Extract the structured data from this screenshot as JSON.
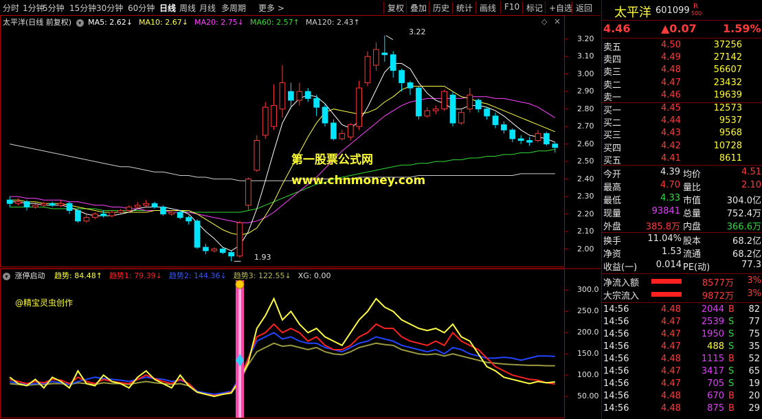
{
  "toolbar": {
    "left": [
      "分时",
      "1分钟",
      "5分钟",
      "15分钟",
      "30分钟",
      "60分钟",
      "日线",
      "周线",
      "月线",
      "多周期",
      "更多 >"
    ],
    "active_index": 6,
    "right": [
      "复权",
      "叠加",
      "历史",
      "统计",
      "画线",
      "F10",
      "标记",
      "+自选",
      "返回"
    ]
  },
  "main_legend": {
    "title": "太平洋(日线 前复权)",
    "ma": [
      {
        "label": "MA5: 2.62↓",
        "color": "#ffffff"
      },
      {
        "label": "MA10: 2.67↓",
        "color": "#ffff44"
      },
      {
        "label": "MA20: 2.75↓",
        "color": "#ff44ff"
      },
      {
        "label": "MA60: 2.57↑",
        "color": "#33dd33"
      },
      {
        "label": "MA120: 2.43↑",
        "color": "#cfcfcf"
      }
    ],
    "high_label": "3.22",
    "low_label": "1.93",
    "watermark1": "第一股票公式网",
    "watermark2": "www.chnmoney.com"
  },
  "price_axis": [
    "3.20",
    "3.10",
    "3.00",
    "2.90",
    "2.80",
    "2.70",
    "2.60",
    "2.50",
    "2.40",
    "2.30",
    "2.20",
    "2.10",
    "2.00"
  ],
  "sub_legend": {
    "title": "涨停启动",
    "items": [
      {
        "label": "趋势: 84.48↑",
        "color": "#ffff44"
      },
      {
        "label": "趋势1: 79.39↓",
        "color": "#ff2222"
      },
      {
        "label": "趋势2: 144.36↓",
        "color": "#3355ff"
      },
      {
        "label": "趋势3: 122.55↓",
        "color": "#bbbb55"
      },
      {
        "label": "XG: 0.00",
        "color": "#dddddd"
      }
    ],
    "author": "@精宝灵虫创作"
  },
  "sub_axis": [
    "300.0",
    "250.0",
    "200.0",
    "150.0",
    "100.0",
    "50.00"
  ],
  "chart_data": {
    "type": "candlestick",
    "ylim": [
      1.9,
      3.25
    ],
    "candles": [
      [
        2.28,
        2.26,
        2.3,
        2.24
      ],
      [
        2.26,
        2.27,
        2.29,
        2.25
      ],
      [
        2.27,
        2.24,
        2.28,
        2.22
      ],
      [
        2.24,
        2.25,
        2.27,
        2.23
      ],
      [
        2.25,
        2.26,
        2.27,
        2.24
      ],
      [
        2.26,
        2.25,
        2.27,
        2.24
      ],
      [
        2.25,
        2.26,
        2.28,
        2.24
      ],
      [
        2.26,
        2.22,
        2.27,
        2.2
      ],
      [
        2.22,
        2.16,
        2.23,
        2.15
      ],
      [
        2.16,
        2.18,
        2.2,
        2.15
      ],
      [
        2.18,
        2.2,
        2.21,
        2.17
      ],
      [
        2.2,
        2.19,
        2.22,
        2.18
      ],
      [
        2.19,
        2.21,
        2.22,
        2.18
      ],
      [
        2.21,
        2.22,
        2.23,
        2.2
      ],
      [
        2.22,
        2.24,
        2.25,
        2.21
      ],
      [
        2.24,
        2.25,
        2.27,
        2.23
      ],
      [
        2.25,
        2.26,
        2.28,
        2.24
      ],
      [
        2.26,
        2.24,
        2.27,
        2.23
      ],
      [
        2.24,
        2.2,
        2.25,
        2.19
      ],
      [
        2.2,
        2.21,
        2.22,
        2.19
      ],
      [
        2.21,
        2.18,
        2.22,
        2.17
      ],
      [
        2.18,
        2.16,
        2.19,
        2.14
      ],
      [
        2.16,
        2.01,
        2.17,
        2.0
      ],
      [
        2.01,
        1.99,
        2.03,
        1.97
      ],
      [
        1.99,
        2.0,
        2.01,
        1.98
      ],
      [
        2.0,
        1.98,
        2.01,
        1.97
      ],
      [
        1.98,
        1.96,
        1.99,
        1.93
      ],
      [
        1.96,
        2.15,
        2.16,
        1.95
      ],
      [
        2.25,
        2.4,
        2.41,
        2.22
      ],
      [
        2.45,
        2.62,
        2.65,
        2.44
      ],
      [
        2.65,
        2.81,
        2.84,
        2.63
      ],
      [
        2.7,
        2.82,
        2.94,
        2.68
      ],
      [
        2.8,
        2.95,
        3.05,
        2.75
      ],
      [
        2.9,
        2.85,
        2.95,
        2.8
      ],
      [
        2.85,
        2.9,
        2.95,
        2.82
      ],
      [
        2.9,
        2.86,
        2.92,
        2.84
      ],
      [
        2.86,
        2.81,
        2.88,
        2.76
      ],
      [
        2.81,
        2.72,
        2.83,
        2.7
      ],
      [
        2.72,
        2.63,
        2.74,
        2.62
      ],
      [
        2.63,
        2.66,
        2.68,
        2.62
      ],
      [
        2.64,
        2.71,
        2.72,
        2.62
      ],
      [
        2.7,
        2.92,
        2.96,
        2.68
      ],
      [
        2.95,
        3.1,
        3.13,
        2.93
      ],
      [
        3.05,
        3.14,
        3.18,
        3.02
      ],
      [
        3.12,
        3.11,
        3.22,
        3.07
      ],
      [
        3.11,
        3.02,
        3.13,
        2.98
      ],
      [
        3.02,
        2.95,
        3.03,
        2.9
      ],
      [
        2.95,
        2.92,
        2.96,
        2.88
      ],
      [
        2.92,
        2.76,
        2.93,
        2.74
      ],
      [
        2.76,
        2.79,
        2.81,
        2.75
      ],
      [
        2.79,
        2.8,
        2.82,
        2.77
      ],
      [
        2.8,
        2.9,
        2.91,
        2.79
      ],
      [
        2.88,
        2.72,
        2.9,
        2.7
      ],
      [
        2.72,
        2.78,
        2.8,
        2.71
      ],
      [
        2.8,
        2.88,
        2.92,
        2.78
      ],
      [
        2.85,
        2.8,
        2.86,
        2.78
      ],
      [
        2.8,
        2.76,
        2.81,
        2.74
      ],
      [
        2.76,
        2.71,
        2.78,
        2.69
      ],
      [
        2.71,
        2.68,
        2.73,
        2.66
      ],
      [
        2.68,
        2.63,
        2.69,
        2.61
      ],
      [
        2.63,
        2.62,
        2.65,
        2.6
      ],
      [
        2.62,
        2.61,
        2.64,
        2.59
      ],
      [
        2.62,
        2.66,
        2.68,
        2.61
      ],
      [
        2.66,
        2.6,
        2.67,
        2.59
      ],
      [
        2.6,
        2.58,
        2.61,
        2.55
      ]
    ],
    "ma5": [
      2.27,
      2.27,
      2.26,
      2.26,
      2.25,
      2.25,
      2.25,
      2.24,
      2.22,
      2.2,
      2.19,
      2.19,
      2.19,
      2.2,
      2.21,
      2.23,
      2.24,
      2.24,
      2.24,
      2.23,
      2.22,
      2.2,
      2.15,
      2.1,
      2.06,
      2.01,
      1.99,
      2.02,
      2.1,
      2.23,
      2.39,
      2.56,
      2.72,
      2.81,
      2.86,
      2.88,
      2.87,
      2.83,
      2.77,
      2.71,
      2.69,
      2.73,
      2.81,
      2.91,
      3.01,
      3.06,
      3.06,
      3.03,
      2.95,
      2.89,
      2.85,
      2.83,
      2.8,
      2.8,
      2.82,
      2.82,
      2.81,
      2.79,
      2.76,
      2.72,
      2.68,
      2.65,
      2.64,
      2.63,
      2.61
    ],
    "ma10": [
      2.28,
      2.28,
      2.27,
      2.27,
      2.26,
      2.26,
      2.26,
      2.25,
      2.24,
      2.23,
      2.22,
      2.21,
      2.21,
      2.21,
      2.21,
      2.21,
      2.21,
      2.22,
      2.22,
      2.22,
      2.22,
      2.22,
      2.2,
      2.17,
      2.14,
      2.11,
      2.09,
      2.08,
      2.09,
      2.12,
      2.19,
      2.27,
      2.37,
      2.46,
      2.55,
      2.64,
      2.72,
      2.78,
      2.8,
      2.79,
      2.78,
      2.77,
      2.78,
      2.8,
      2.84,
      2.87,
      2.91,
      2.93,
      2.93,
      2.93,
      2.93,
      2.93,
      2.9,
      2.87,
      2.86,
      2.84,
      2.83,
      2.81,
      2.79,
      2.77,
      2.75,
      2.73,
      2.71,
      2.69,
      2.67
    ],
    "ma20": [
      2.3,
      2.3,
      2.29,
      2.29,
      2.28,
      2.28,
      2.28,
      2.27,
      2.27,
      2.26,
      2.25,
      2.25,
      2.24,
      2.24,
      2.23,
      2.23,
      2.22,
      2.22,
      2.22,
      2.21,
      2.21,
      2.21,
      2.2,
      2.19,
      2.18,
      2.17,
      2.16,
      2.15,
      2.15,
      2.16,
      2.18,
      2.21,
      2.25,
      2.29,
      2.33,
      2.37,
      2.41,
      2.46,
      2.51,
      2.56,
      2.6,
      2.64,
      2.68,
      2.72,
      2.76,
      2.79,
      2.82,
      2.84,
      2.85,
      2.86,
      2.86,
      2.86,
      2.86,
      2.86,
      2.87,
      2.87,
      2.87,
      2.86,
      2.86,
      2.85,
      2.84,
      2.83,
      2.81,
      2.78,
      2.75
    ],
    "ma60": [
      2.24,
      2.24,
      2.24,
      2.24,
      2.24,
      2.23,
      2.23,
      2.23,
      2.23,
      2.23,
      2.23,
      2.22,
      2.22,
      2.22,
      2.22,
      2.22,
      2.22,
      2.22,
      2.22,
      2.22,
      2.22,
      2.21,
      2.21,
      2.21,
      2.21,
      2.21,
      2.21,
      2.21,
      2.22,
      2.23,
      2.25,
      2.27,
      2.29,
      2.31,
      2.33,
      2.35,
      2.37,
      2.38,
      2.4,
      2.41,
      2.42,
      2.43,
      2.44,
      2.45,
      2.46,
      2.47,
      2.48,
      2.48,
      2.49,
      2.49,
      2.5,
      2.5,
      2.51,
      2.51,
      2.52,
      2.52,
      2.53,
      2.53,
      2.54,
      2.54,
      2.55,
      2.55,
      2.56,
      2.56,
      2.57
    ],
    "ma120": [
      2.6,
      2.59,
      2.58,
      2.57,
      2.56,
      2.55,
      2.54,
      2.53,
      2.52,
      2.51,
      2.5,
      2.49,
      2.48,
      2.47,
      2.47,
      2.46,
      2.45,
      2.44,
      2.44,
      2.43,
      2.42,
      2.42,
      2.41,
      2.41,
      2.4,
      2.4,
      2.4,
      2.39,
      2.39,
      2.39,
      2.39,
      2.39,
      2.39,
      2.39,
      2.4,
      2.4,
      2.4,
      2.4,
      2.4,
      2.4,
      2.4,
      2.41,
      2.41,
      2.41,
      2.41,
      2.41,
      2.41,
      2.41,
      2.42,
      2.42,
      2.42,
      2.42,
      2.42,
      2.42,
      2.42,
      2.42,
      2.42,
      2.42,
      2.42,
      2.42,
      2.43,
      2.43,
      2.43,
      2.43,
      2.43
    ],
    "sub_ylim": [
      0,
      320
    ],
    "trend": [
      95,
      80,
      75,
      90,
      70,
      95,
      85,
      70,
      110,
      80,
      75,
      100,
      85,
      80,
      70,
      95,
      110,
      90,
      80,
      70,
      100,
      75,
      60,
      55,
      50,
      55,
      58,
      90,
      130,
      210,
      240,
      280,
      230,
      250,
      220,
      200,
      210,
      190,
      180,
      170,
      200,
      230,
      250,
      280,
      260,
      250,
      230,
      220,
      210,
      205,
      210,
      200,
      220,
      190,
      180,
      150,
      120,
      110,
      95,
      90,
      85,
      80,
      85,
      82,
      84
    ],
    "trend1": [
      90,
      85,
      80,
      85,
      82,
      90,
      88,
      80,
      95,
      85,
      80,
      90,
      85,
      82,
      80,
      90,
      100,
      92,
      85,
      80,
      90,
      80,
      60,
      55,
      52,
      55,
      60,
      90,
      140,
      190,
      200,
      220,
      200,
      210,
      200,
      180,
      190,
      170,
      160,
      160,
      170,
      190,
      200,
      220,
      210,
      210,
      190,
      180,
      175,
      170,
      180,
      170,
      200,
      180,
      170,
      160,
      140,
      120,
      110,
      100,
      95,
      90,
      88,
      82,
      79
    ],
    "trend2": [
      85,
      80,
      78,
      80,
      80,
      85,
      82,
      78,
      85,
      90,
      95,
      92,
      90,
      88,
      85,
      90,
      95,
      92,
      90,
      85,
      88,
      80,
      62,
      58,
      55,
      58,
      62,
      95,
      140,
      180,
      190,
      200,
      185,
      190,
      180,
      175,
      175,
      165,
      160,
      155,
      165,
      175,
      180,
      190,
      185,
      180,
      170,
      165,
      160,
      155,
      160,
      150,
      165,
      160,
      150,
      145,
      140,
      140,
      142,
      140,
      135,
      140,
      145,
      145,
      144
    ],
    "trend3": [
      80,
      78,
      76,
      78,
      78,
      80,
      80,
      78,
      82,
      80,
      78,
      82,
      80,
      80,
      78,
      82,
      85,
      82,
      80,
      78,
      80,
      75,
      60,
      55,
      52,
      55,
      58,
      85,
      125,
      155,
      165,
      175,
      168,
      170,
      165,
      160,
      165,
      155,
      150,
      148,
      155,
      165,
      170,
      175,
      172,
      170,
      160,
      155,
      150,
      148,
      150,
      145,
      150,
      145,
      140,
      135,
      130,
      128,
      126,
      125,
      124,
      123,
      123,
      122,
      122
    ]
  },
  "stock": {
    "name": "太平洋",
    "code": "601099",
    "badge_top": "R",
    "badge_bottom": "500",
    "price": "4.46",
    "change": "▲0.07",
    "pct": "1.59%"
  },
  "orderbook": [
    {
      "label": "卖五",
      "price": "4.50",
      "vol": "37256"
    },
    {
      "label": "卖四",
      "price": "4.49",
      "vol": "27142"
    },
    {
      "label": "卖三",
      "price": "4.48",
      "vol": "56607"
    },
    {
      "label": "卖二",
      "price": "4.47",
      "vol": "23432"
    },
    {
      "label": "卖一",
      "price": "4.46",
      "vol": "19639"
    },
    {
      "label": "买一",
      "price": "4.45",
      "vol": "12573"
    },
    {
      "label": "买二",
      "price": "4.44",
      "vol": "9537"
    },
    {
      "label": "买三",
      "price": "4.43",
      "vol": "9568"
    },
    {
      "label": "买四",
      "price": "4.42",
      "vol": "10728"
    },
    {
      "label": "买五",
      "price": "4.41",
      "vol": "8611"
    }
  ],
  "stats": [
    {
      "l1": "今开",
      "v1": "4.39",
      "c1": "#e8e8e8",
      "l2": "均价",
      "v2": "4.51",
      "c2": "#ff3b3b"
    },
    {
      "l1": "最高",
      "v1": "4.70",
      "c1": "#ff3b3b",
      "l2": "量比",
      "v2": "2.10",
      "c2": "#ff3b3b"
    },
    {
      "l1": "最低",
      "v1": "4.33",
      "c1": "#34d844",
      "l2": "市值",
      "v2": "304.0亿",
      "c2": "#e8e8e8"
    },
    {
      "l1": "现量",
      "v1": "93841",
      "c1": "#e040fb",
      "l2": "总量",
      "v2": "752.4万",
      "c2": "#e8e8e8"
    },
    {
      "l1": "外盘",
      "v1": "385.8万",
      "c1": "#ff3b3b",
      "l2": "内盘",
      "v2": "366.6万",
      "c2": "#34d844"
    }
  ],
  "stats2": [
    {
      "l1": "换手",
      "v1": "11.04%",
      "l2": "股本",
      "v2": "68.2亿"
    },
    {
      "l1": "净资",
      "v1": "1.53",
      "l2": "流通",
      "v2": "68.2亿"
    },
    {
      "l1": "收益(一)",
      "v1": "0.014",
      "l2": "PE(动)",
      "v2": "77.3"
    }
  ],
  "flows": [
    {
      "label": "净流入额",
      "value": "8577万",
      "pct": "3%"
    },
    {
      "label": "大宗流入",
      "value": "9872万",
      "pct": "3%"
    }
  ],
  "ticks": [
    {
      "t": "14:56",
      "p": "4.48",
      "v": "2044",
      "vc": "#e040fb",
      "d": "B",
      "n": "82"
    },
    {
      "t": "14:56",
      "p": "4.47",
      "v": "2539",
      "vc": "#e040fb",
      "d": "S",
      "n": "77"
    },
    {
      "t": "14:56",
      "p": "4.47",
      "v": "1950",
      "vc": "#e040fb",
      "d": "S",
      "n": "75"
    },
    {
      "t": "14:56",
      "p": "4.47",
      "v": "488",
      "vc": "#ffff33",
      "d": "S",
      "n": "35"
    },
    {
      "t": "14:56",
      "p": "4.48",
      "v": "1115",
      "vc": "#e040fb",
      "d": "B",
      "n": "52"
    },
    {
      "t": "14:56",
      "p": "4.47",
      "v": "3417",
      "vc": "#e040fb",
      "d": "S",
      "n": "65"
    },
    {
      "t": "14:56",
      "p": "4.47",
      "v": "705",
      "vc": "#e040fb",
      "d": "S",
      "n": "19"
    },
    {
      "t": "14:56",
      "p": "4.48",
      "v": "670",
      "vc": "#e040fb",
      "d": "B",
      "n": "20"
    },
    {
      "t": "14:56",
      "p": "4.48",
      "v": "875",
      "vc": "#e040fb",
      "d": "B",
      "n": "29"
    }
  ],
  "colors": {
    "up": "#ff3b3b",
    "down": "#00e5ff",
    "frame": "#b00000",
    "bg": "#000000"
  }
}
